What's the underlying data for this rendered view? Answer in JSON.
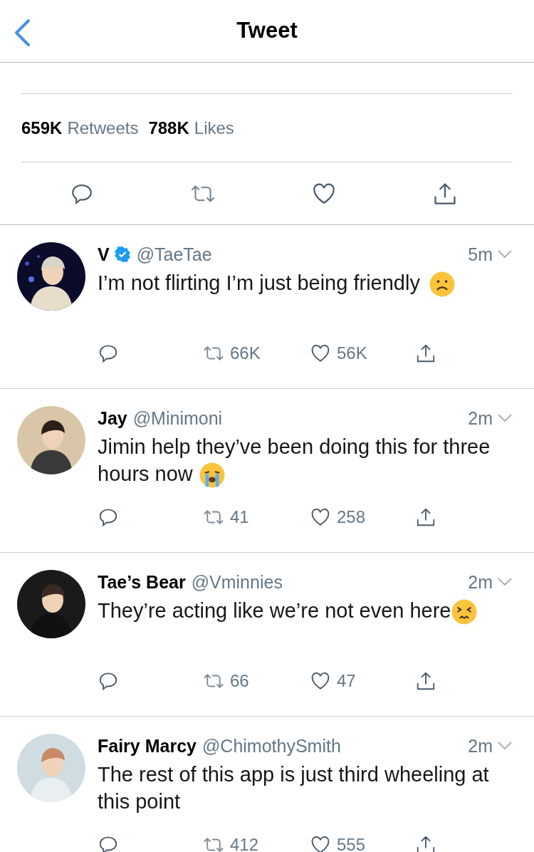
{
  "header": {
    "title": "Tweet"
  },
  "stats": [
    {
      "count": "659K",
      "label": "Retweets"
    },
    {
      "count": "788K",
      "label": "Likes"
    }
  ],
  "replies": [
    {
      "name": "V",
      "verified": true,
      "handle": "@TaeTae",
      "time": "5m",
      "text": "I’m not flirting I’m just being friendly",
      "emoji": {
        "kind": "frown"
      },
      "retweets": "66K",
      "likes": "56K"
    },
    {
      "name": "Jay",
      "verified": false,
      "handle": "@Minimoni",
      "time": "2m",
      "text": "Jimin help they’ve been doing this for three hours now",
      "emoji": {
        "kind": "sob"
      },
      "retweets": "41",
      "likes": "258"
    },
    {
      "name": "Tae’s Bear",
      "verified": false,
      "handle": "@Vminnies",
      "time": "2m",
      "text": "They’re acting like we’re not even here",
      "emoji": {
        "kind": "persevere"
      },
      "retweets": "66",
      "likes": "47"
    },
    {
      "name": "Fairy Marcy",
      "verified": false,
      "handle": "@ChimothySmith",
      "time": "2m",
      "text": "The rest of this app is just third wheeling at this point",
      "retweets": "412",
      "likes": "555"
    }
  ]
}
